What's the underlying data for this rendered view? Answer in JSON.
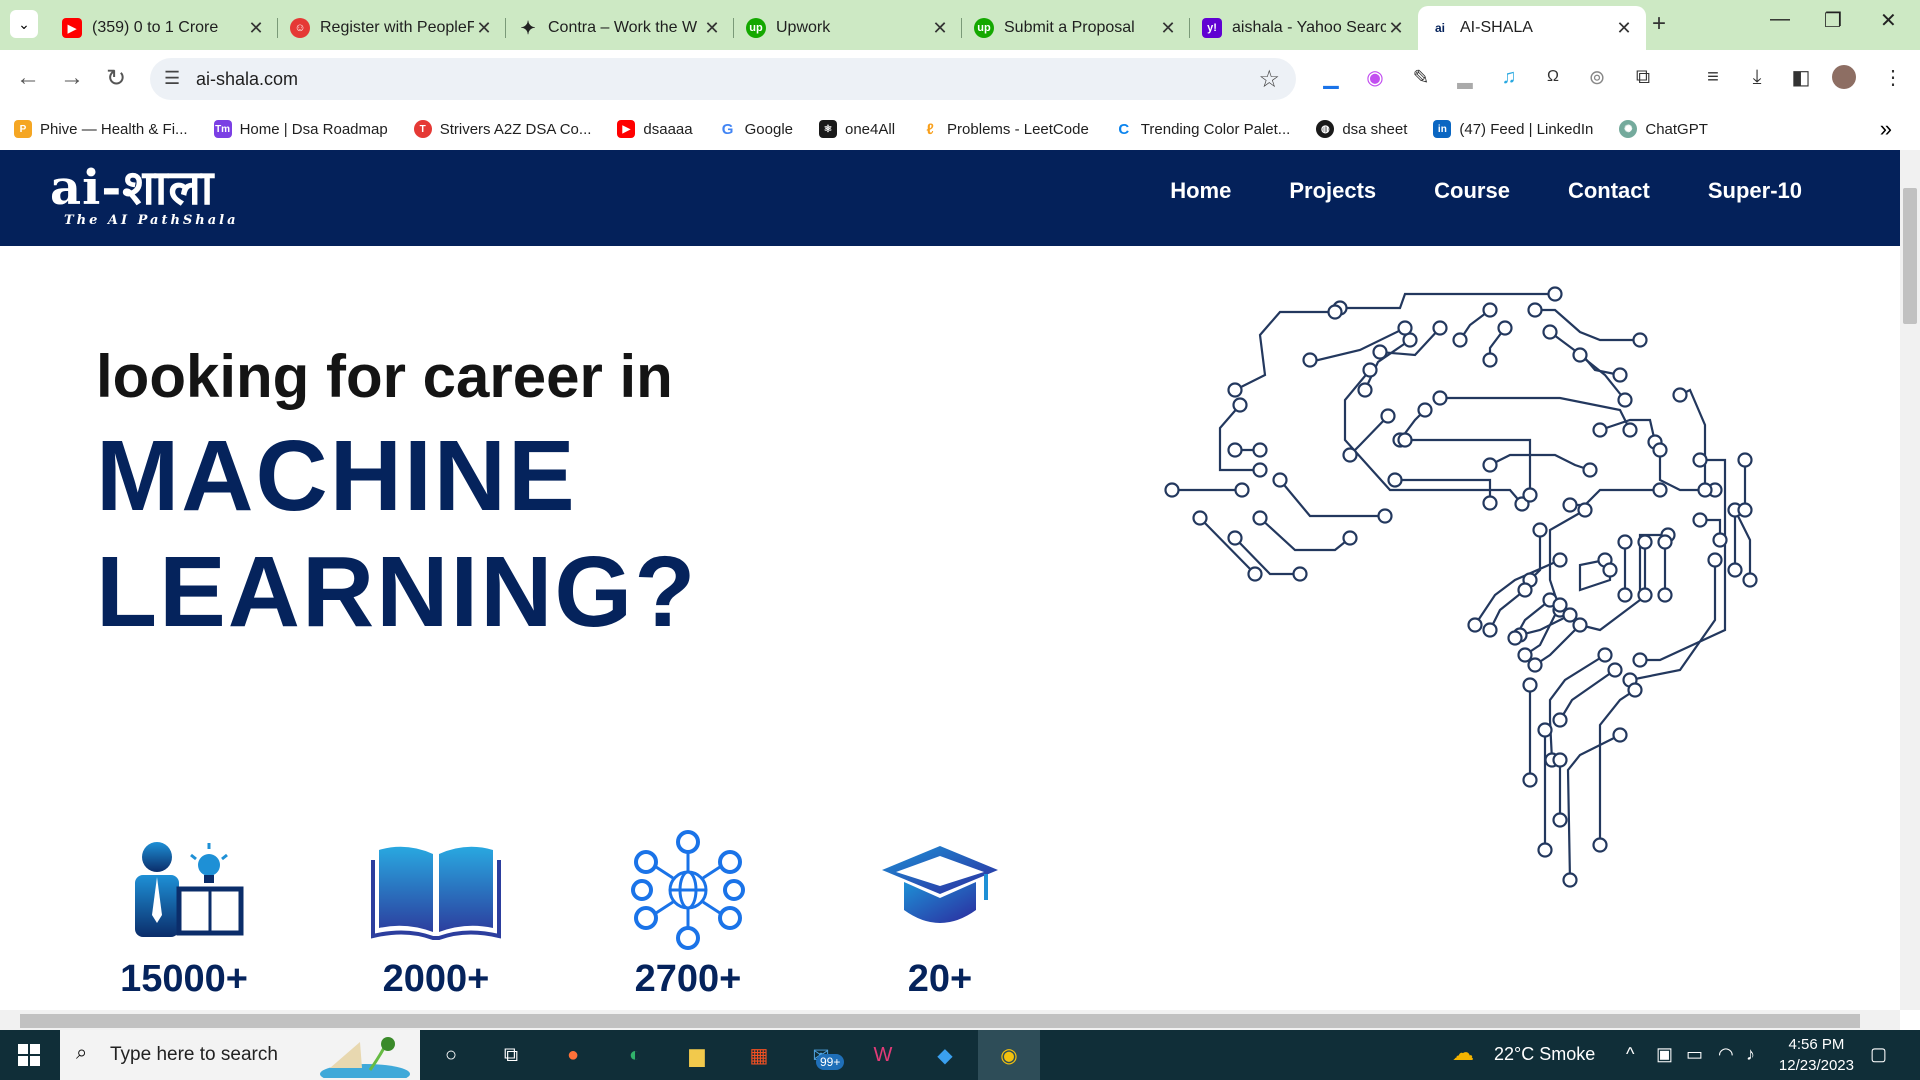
{
  "browser": {
    "tabs": [
      {
        "title": "(359) 0 to 1 Crore",
        "icon": "youtube-icon",
        "color": "#ff0000"
      },
      {
        "title": "Register with PeopleF",
        "icon": "peoplef-icon",
        "color": "#e53935"
      },
      {
        "title": "Contra – Work the W",
        "icon": "contra-icon",
        "color": "#222222"
      },
      {
        "title": "Upwork",
        "icon": "upwork-icon",
        "color": "#14a800"
      },
      {
        "title": "Submit a Proposal",
        "icon": "upwork-icon",
        "color": "#14a800"
      },
      {
        "title": "aishala - Yahoo Searc",
        "icon": "yahoo-icon",
        "color": "#6001d2"
      },
      {
        "title": "AI-SHALA",
        "icon": "aishala-icon",
        "color": "#04215a"
      }
    ],
    "url": "ai-shala.com",
    "bookmarks": [
      {
        "label": "Phive — Health & Fi...",
        "color": "#f5a623"
      },
      {
        "label": "Home | Dsa Roadmap",
        "color": "#7b3fe4"
      },
      {
        "label": "Strivers A2Z DSA Co...",
        "color": "#e53935"
      },
      {
        "label": "dsaaaa",
        "color": "#ff0000"
      },
      {
        "label": "Google",
        "color": "#4285f4"
      },
      {
        "label": "one4All",
        "color": "#1a1a1a"
      },
      {
        "label": "Problems - LeetCode",
        "color": "#f89f1b"
      },
      {
        "label": "Trending Color Palet...",
        "color": "#0b84ee"
      },
      {
        "label": "dsa sheet",
        "color": "#1a1a1a"
      },
      {
        "label": "(47) Feed | LinkedIn",
        "color": "#0a66c2"
      },
      {
        "label": "ChatGPT",
        "color": "#74aa9c"
      }
    ]
  },
  "site": {
    "logo_main": "ai-शाला",
    "logo_sub": "The AI PathShala",
    "nav": [
      "Home",
      "Projects",
      "Course",
      "Contact",
      "Super-10"
    ],
    "hero_line1": "looking for career in",
    "hero_line2": "MACHINE",
    "hero_line3": "LEARNING?",
    "stats": [
      "15000+",
      "2000+",
      "2700+",
      "20+"
    ],
    "brand_color": "#04215a"
  },
  "taskbar": {
    "search_placeholder": "Type here to search",
    "mail_badge": "99+",
    "weather": "22°C  Smoke",
    "time": "4:56 PM",
    "date": "12/23/2023"
  }
}
